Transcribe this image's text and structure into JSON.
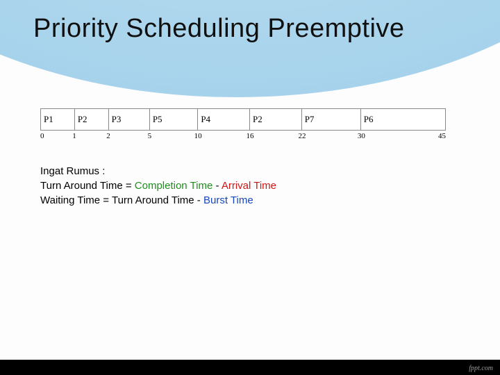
{
  "title": "Priority Scheduling Preemptive",
  "gantt": {
    "total": 45,
    "segments": [
      {
        "label": "P1",
        "start": 0,
        "end": 1
      },
      {
        "label": "P2",
        "start": 1,
        "end": 2
      },
      {
        "label": "P3",
        "start": 2,
        "end": 5
      },
      {
        "label": "P5",
        "start": 5,
        "end": 10
      },
      {
        "label": "P4",
        "start": 10,
        "end": 16
      },
      {
        "label": "P2",
        "start": 16,
        "end": 22
      },
      {
        "label": "P7",
        "start": 22,
        "end": 30
      },
      {
        "label": "P6",
        "start": 30,
        "end": 45
      }
    ],
    "ticks": [
      "0",
      "1",
      "2",
      "5",
      "10",
      "16",
      "22",
      "30",
      "45"
    ]
  },
  "formulas": {
    "intro": "Ingat Rumus :",
    "line1_a": "Turn Around Time",
    "line1_eq": " = ",
    "line1_b": "Completion Time",
    "line1_dash": " - ",
    "line1_c": "Arrival Time",
    "line2_a": "Waiting Time",
    "line2_eq": " = ",
    "line2_b": "Turn Around Time",
    "line2_dash": " - ",
    "line2_c": "Burst Time"
  },
  "credit": "fppt.com"
}
